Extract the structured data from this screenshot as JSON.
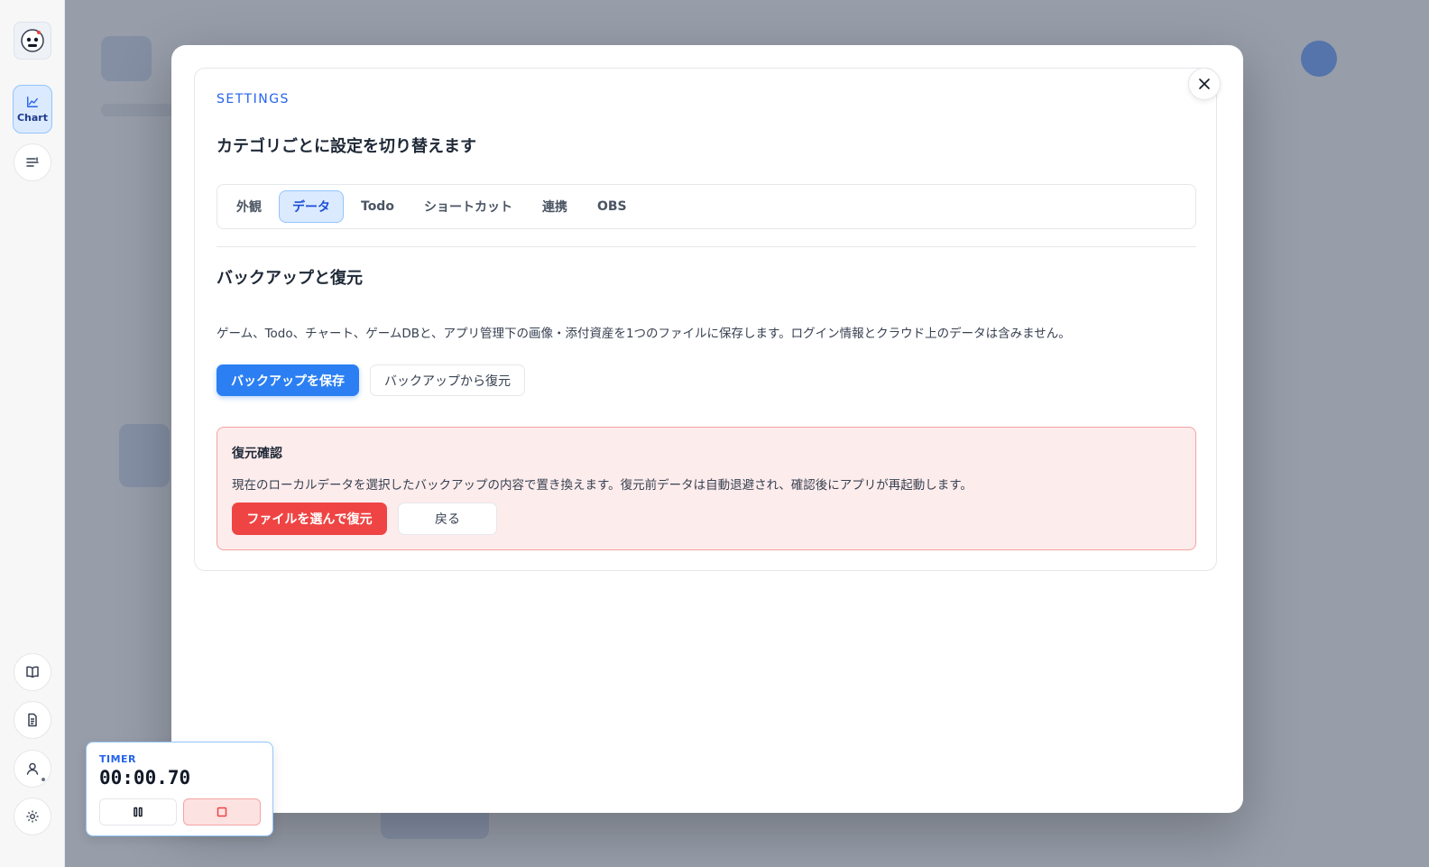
{
  "sidebar": {
    "chart_label": "Chart"
  },
  "modal": {
    "kicker": "SETTINGS",
    "title": "カテゴリごとに設定を切り替えます",
    "tabs": [
      {
        "label": "外観",
        "active": false
      },
      {
        "label": "データ",
        "active": true
      },
      {
        "label": "Todo",
        "active": false
      },
      {
        "label": "ショートカット",
        "active": false
      },
      {
        "label": "連携",
        "active": false
      },
      {
        "label": "OBS",
        "active": false
      }
    ],
    "section_title": "バックアップと復元",
    "description": "ゲーム、Todo、チャート、ゲームDBと、アプリ管理下の画像・添付資産を1つのファイルに保存します。ログイン情報とクラウド上のデータは含みません。",
    "save_backup_label": "バックアップを保存",
    "restore_backup_label": "バックアップから復元",
    "confirm": {
      "title": "復元確認",
      "description": "現在のローカルデータを選択したバックアップの内容で置き換えます。復元前データは自動退避され、確認後にアプリが再起動します。",
      "choose_file_label": "ファイルを選んで復元",
      "back_label": "戻る"
    }
  },
  "timer": {
    "label": "TIMER",
    "value": "00:00.70"
  },
  "colors": {
    "accent": "#2b7ff2",
    "danger": "#ef4444",
    "confirm_bg": "#fdecec"
  }
}
